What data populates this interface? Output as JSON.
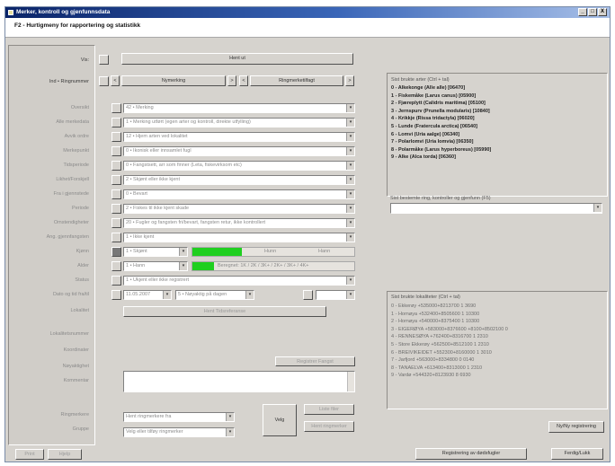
{
  "window": {
    "title": "Merker, kontroll og gjenfunnsdata",
    "controls": [
      "_",
      "□",
      "X"
    ]
  },
  "subheader": "F2 - Hurtigmeny for rapportering og statistikk",
  "sidebar": [
    "Vis:",
    "Ind • Ringnummer",
    "Oversikt",
    "Alle merkedata",
    "Avvik ordre",
    "Merkepunkt",
    "Tidsperiode",
    "Likhet/Forskjell",
    "Fra i gjennstede",
    "Periode",
    "Omstendigheter",
    "Ang. gjennfangsten",
    "Kjønn",
    "Alder",
    "Status",
    "Dato og tid fra/til",
    "Lokalitet",
    "Lokalitetsnummer",
    "Koordinater",
    "Nøyaktighet",
    "Kommentar",
    "Ringmerkere",
    "Gruppe"
  ],
  "toolbar": {
    "main_button": "Hent ut",
    "left_button": "Nymerking",
    "right_button": "Ringmerketilfagt",
    "nav_prev": "<",
    "nav_next": ">"
  },
  "fields": [
    "42 • Merking",
    "1 • Merking utført (egen arter og kontroll, direkte utfylling)",
    "12 • Hjem arten ved lokalitet",
    "0 • Ikonisk eller innsamlet fugl",
    "0 • Fangstsett, arr som finner (Leta, fiskevirksom etc)",
    "2 • Skjønt eller ikke kjent",
    "0 • Bevart",
    "2 • Fiskes til ikke kjent skade",
    "20 • Fugler og fangsten fri/bevart, fangsten retur, ikke kontrollert",
    "1 • Ikke kjent",
    "1 • Skjønt",
    "1 • Hann",
    "1 • Ukjent eller ikke registrert",
    "11.05.2007",
    "5 • Nøyaktig på dagen"
  ],
  "kjonn_bar": {
    "tabs": [
      "Hunn",
      "Hann"
    ]
  },
  "alder_bar": {
    "label": "Beregnet: 1K / 2K / 3K+ / 2K+ / 3K+ / 4K+"
  },
  "lokalitet_button": "Hent Tidsreferanse",
  "nyfoto_button": "Registrer Fangst",
  "ringmerkere_select": "Hent ringmerkere fra",
  "gruppe_select": "Velg eller tilføy ringmerker",
  "mid_button": "Velg",
  "side_buttons": [
    "Liste filer",
    "Hent ringmerker"
  ],
  "top_species": {
    "title": "Sist brukte arter (Ctrl + tal)",
    "items": [
      "0 - Alkekonge (Alle alle) [06470]",
      "1 - Fiskemåke (Larus canus) [05900]",
      "2 - Fjæreplytt (Calidris maritima) [05100]",
      "3 - Jernspurv (Prunella modularis) [10840]",
      "4 - Krikkje (Rissa tridactyla) [06020]",
      "5 - Lunde (Fratercula arctica) [06540]",
      "6 - Lomvi (Uria aalge) [06340]",
      "7 - Polarlomvi (Uria lomvia) [06350]",
      "8 - Polarmåke (Larus hyperboreus) [05990]",
      "9 - Alke (Alca torda) [06360]"
    ]
  },
  "ring_search": {
    "title": "Sist bestemte ring, kontroller og gjenfunn (F5)",
    "value": ""
  },
  "last_locations": {
    "title": "Sist brukte lokaliteter (Ctrl + tal)",
    "items": [
      "0 - Ekkerøy +535000+8213700 1 3690",
      "1 - Hornøya +532400+8505600 1 10300",
      "2 - Hornøya +540000+8375400 1 10300",
      "3 - EIGERØYA +583000+8376600 +8100+8502100 0",
      "4 - RENNESØYA +762400+8316700 1 2310",
      "5 - Store Ekkerøy +562500+8512100 1 2310",
      "6 - BREIVIKEIDET +552300+8160000 1 3010",
      "7 - Jarfjord +563000+8334800 0 0140",
      "8 - TANAELVA +613400+8313000 1 2310",
      "9 - Vardø +544320+8123930 8 6930"
    ]
  },
  "bottom": {
    "left_buttons": [
      "Print",
      "Hjelp"
    ],
    "register_button": "Registrering av dødsfugler",
    "close_button": "Ferdig/Lukk",
    "new_button": "Ny/Ny registrering"
  }
}
